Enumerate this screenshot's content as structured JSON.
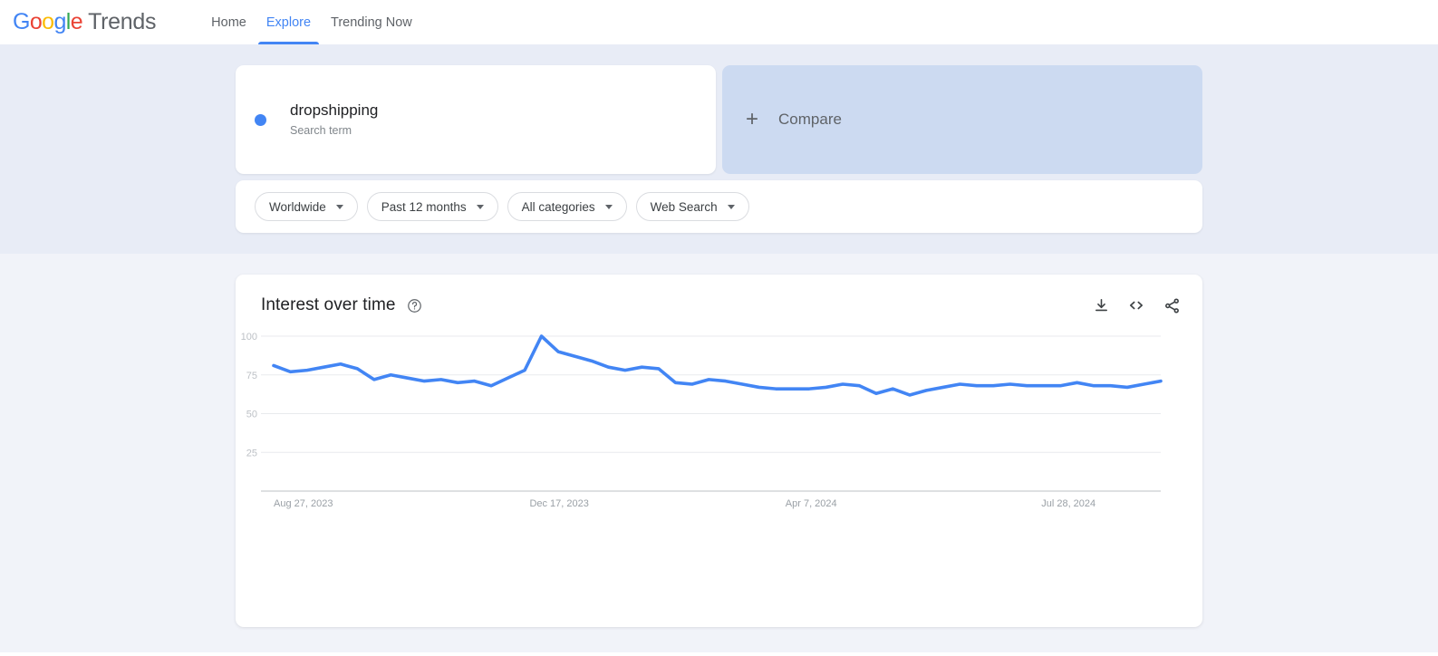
{
  "header": {
    "brand": {
      "google": "Google",
      "product": "Trends"
    },
    "nav": [
      {
        "label": "Home",
        "active": false
      },
      {
        "label": "Explore",
        "active": true
      },
      {
        "label": "Trending Now",
        "active": false
      }
    ]
  },
  "query": {
    "term": {
      "name": "dropshipping",
      "type_label": "Search term",
      "color": "#4285F4"
    },
    "compare": {
      "label": "Compare",
      "plus": "+"
    }
  },
  "filters": [
    {
      "label": "Worldwide"
    },
    {
      "label": "Past 12 months"
    },
    {
      "label": "All categories"
    },
    {
      "label": "Web Search"
    }
  ],
  "chart_card": {
    "title": "Interest over time",
    "help": "?",
    "actions": [
      {
        "name": "download-icon"
      },
      {
        "name": "embed-code-icon"
      },
      {
        "name": "share-icon"
      }
    ]
  },
  "chart_data": {
    "type": "line",
    "title": "Interest over time",
    "xlabel": "",
    "ylabel": "",
    "ylim": [
      0,
      100
    ],
    "yticks": [
      25,
      50,
      75,
      100
    ],
    "xticks": [
      "Aug 27, 2023",
      "Dec 17, 2023",
      "Apr 7, 2024",
      "Jul 28, 2024"
    ],
    "xtick_positions": [
      0,
      0.2885,
      0.5769,
      0.8654
    ],
    "grid": true,
    "legend": false,
    "line_color": "#4285F4",
    "line_width": 3.6,
    "series": [
      {
        "name": "dropshipping",
        "values": [
          81,
          77,
          78,
          80,
          82,
          79,
          72,
          75,
          73,
          71,
          72,
          70,
          71,
          68,
          73,
          78,
          100,
          90,
          87,
          84,
          80,
          78,
          80,
          79,
          70,
          69,
          72,
          71,
          69,
          67,
          66,
          66,
          66,
          67,
          69,
          68,
          63,
          66,
          62,
          65,
          67,
          69,
          68,
          68,
          69,
          68,
          68,
          68,
          70,
          68,
          68,
          67,
          69,
          71
        ]
      }
    ]
  }
}
